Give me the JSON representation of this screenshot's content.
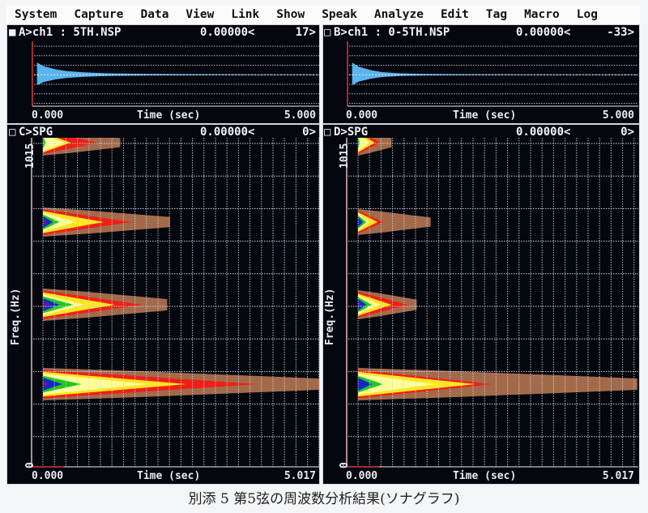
{
  "menu": [
    "System",
    "Capture",
    "Data",
    "View",
    "Link",
    "Show",
    "Speak",
    "Analyze",
    "Edit",
    "Tag",
    "Macro",
    "Log"
  ],
  "panels": {
    "A": {
      "marker": "■",
      "title": "A>ch1 : 5TH.NSP",
      "cursor": "0.00000<",
      "value": "17>",
      "x_start": "0.000",
      "x_end": "5.000",
      "xlabel": "Time (sec)"
    },
    "B": {
      "marker": "□",
      "title": "B>ch1 : 0-5TH.NSP",
      "cursor": "0.00000<",
      "value": "-33>",
      "x_start": "0.000",
      "x_end": "5.000",
      "xlabel": "Time (sec)"
    },
    "C": {
      "marker": "□",
      "title": "C>SPG",
      "cursor": "0.00000<",
      "value": "0>",
      "x_start": "0.000",
      "x_end": "5.017",
      "xlabel": "Time (sec)",
      "ylabel": "Freq.(Hz)",
      "y_top": "1015",
      "y_bottom": "0"
    },
    "D": {
      "marker": "□",
      "title": "D>SPG",
      "cursor": "0.00000<",
      "value": "0>",
      "x_start": "0.000",
      "x_end": "5.017",
      "xlabel": "Time (sec)",
      "ylabel": "Freq.(Hz)",
      "y_top": "1015",
      "y_bottom": "0"
    }
  },
  "caption": "別添 5 第5弦の周波数分析結果(ソナグラフ)",
  "colors": {
    "bg": "#05070e",
    "grid": "#c8d4e6",
    "wave": "#5ab4f0",
    "cursor": "#d23a3a",
    "levels": [
      "#a36a4a",
      "#f01e14",
      "#ffe61e",
      "#ffff9a",
      "#1ec81e",
      "#1428c8",
      "#5a1e8c"
    ]
  },
  "chart_data": [
    {
      "type": "line",
      "panel": "A",
      "title": "ch1 : 5TH.NSP",
      "xlabel": "Time (sec)",
      "xlim": [
        0,
        5.0
      ],
      "series": [
        {
          "name": "amplitude envelope",
          "x": [
            0.08,
            0.2,
            0.4,
            0.6,
            0.9,
            1.3,
            2.0,
            3.0,
            4.0,
            5.0
          ],
          "y": [
            1.0,
            0.7,
            0.45,
            0.3,
            0.2,
            0.12,
            0.07,
            0.04,
            0.02,
            0.01
          ]
        }
      ]
    },
    {
      "type": "line",
      "panel": "B",
      "title": "ch1 : 0-5TH.NSP",
      "xlabel": "Time (sec)",
      "xlim": [
        0,
        5.0
      ],
      "series": [
        {
          "name": "amplitude envelope",
          "x": [
            0.08,
            0.2,
            0.4,
            0.6,
            0.9,
            1.3,
            2.0,
            3.0,
            4.0,
            5.0
          ],
          "y": [
            1.0,
            0.65,
            0.38,
            0.22,
            0.12,
            0.07,
            0.04,
            0.02,
            0.01,
            0.01
          ]
        }
      ]
    },
    {
      "type": "heatmap",
      "panel": "C",
      "title": "SPG",
      "xlabel": "Time (sec)",
      "ylabel": "Freq.(Hz)",
      "xlim": [
        0,
        5.017
      ],
      "ylim": [
        0,
        1015
      ],
      "bands": [
        {
          "freq_hz": 1000,
          "half_width_hz": 40,
          "decay_end_sec": 1.4,
          "levels_end_sec": [
            1.4,
            1.0,
            0.5,
            0.4,
            0.05,
            0,
            0
          ]
        },
        {
          "freq_hz": 755,
          "half_width_hz": 45,
          "decay_end_sec": 2.3,
          "levels_end_sec": [
            2.3,
            1.6,
            1.1,
            0.6,
            0.3,
            0.18,
            0.08
          ]
        },
        {
          "freq_hz": 500,
          "half_width_hz": 50,
          "decay_end_sec": 2.25,
          "levels_end_sec": [
            2.25,
            1.8,
            1.3,
            0.75,
            0.55,
            0.3,
            0.15
          ]
        },
        {
          "freq_hz": 255,
          "half_width_hz": 50,
          "decay_end_sec": 5.0,
          "levels_end_sec": [
            5.0,
            3.9,
            2.6,
            1.9,
            0.7,
            0.35,
            0.1
          ]
        }
      ]
    },
    {
      "type": "heatmap",
      "panel": "D",
      "title": "SPG",
      "xlabel": "Time (sec)",
      "ylabel": "Freq.(Hz)",
      "xlim": [
        0,
        5.017
      ],
      "ylim": [
        0,
        1015
      ],
      "bands": [
        {
          "freq_hz": 1000,
          "half_width_hz": 40,
          "decay_end_sec": 0.6,
          "levels_end_sec": [
            0.6,
            0.4,
            0.3,
            0.2,
            0.03,
            0,
            0
          ]
        },
        {
          "freq_hz": 755,
          "half_width_hz": 40,
          "decay_end_sec": 1.3,
          "levels_end_sec": [
            1.3,
            0.45,
            0.35,
            0.2,
            0.15,
            0.09,
            0
          ]
        },
        {
          "freq_hz": 500,
          "half_width_hz": 45,
          "decay_end_sec": 1.05,
          "levels_end_sec": [
            1.05,
            0.9,
            0.6,
            0.4,
            0.25,
            0.15,
            0.05
          ]
        },
        {
          "freq_hz": 255,
          "half_width_hz": 50,
          "decay_end_sec": 5.0,
          "levels_end_sec": [
            5.0,
            2.4,
            2.1,
            1.4,
            0.45,
            0.25,
            0
          ]
        }
      ]
    }
  ]
}
